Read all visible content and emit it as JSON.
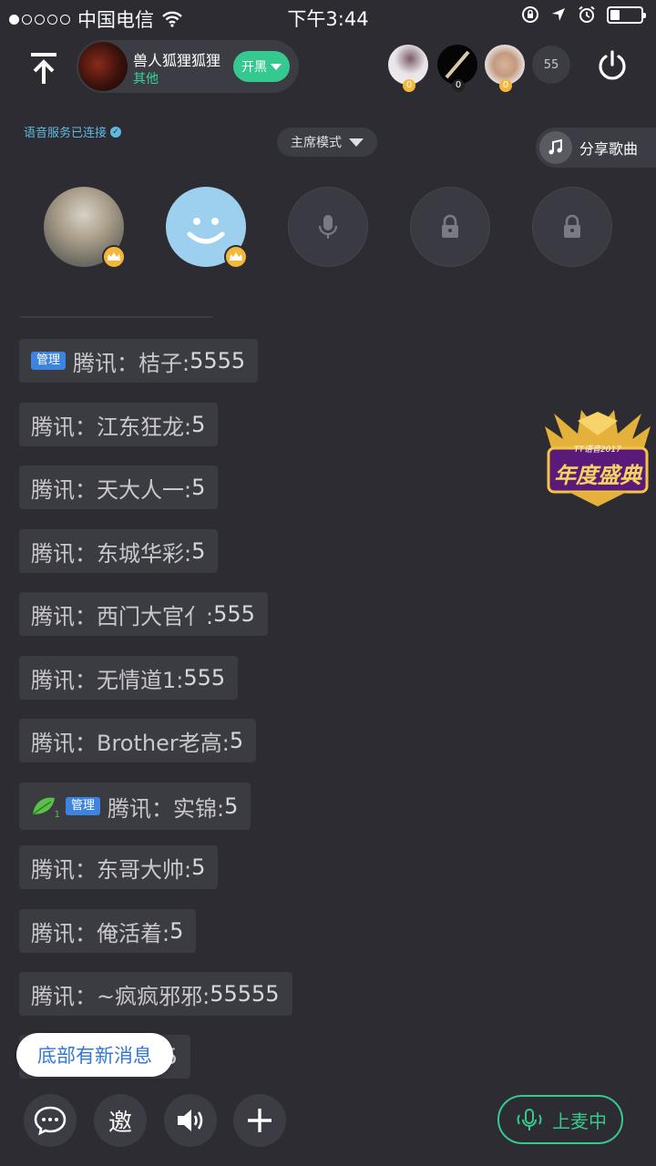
{
  "status_bar": {
    "carrier": "中国电信",
    "time": "下午3:44",
    "signal_dots_full": 1,
    "signal_dots_total": 5,
    "battery_level": 0.3
  },
  "room": {
    "name": "兽人狐狸狐狸",
    "category": "其他",
    "tag_button": "开黑",
    "listener_count": "55",
    "listeners": [
      {
        "badge": "0"
      },
      {
        "badge": "0"
      },
      {
        "badge": "0"
      }
    ]
  },
  "voice_status": "语音服务已连接",
  "mode_selector": "主席模式",
  "share_song": "分享歌曲",
  "seats": [
    {
      "type": "avatar-photo",
      "crown": true
    },
    {
      "type": "avatar-smiley",
      "crown": true
    },
    {
      "type": "mic",
      "crown": false
    },
    {
      "type": "locked",
      "crown": false
    },
    {
      "type": "locked",
      "crown": false
    }
  ],
  "messages": [
    {
      "admin": true,
      "leaf": false,
      "sender": "腾讯：桔子:",
      "text": " 5555"
    },
    {
      "admin": false,
      "leaf": false,
      "sender": "腾讯：江东狂龙:",
      "text": " 5"
    },
    {
      "admin": false,
      "leaf": false,
      "sender": "腾讯：天大人一:",
      "text": " 5"
    },
    {
      "admin": false,
      "leaf": false,
      "sender": "腾讯：东城华彩:",
      "text": " 5"
    },
    {
      "admin": false,
      "leaf": false,
      "sender": "腾讯：西门大官亻:",
      "text": " 555"
    },
    {
      "admin": false,
      "leaf": false,
      "sender": "腾讯：无情道1:",
      "text": " 555"
    },
    {
      "admin": false,
      "leaf": false,
      "sender": "腾讯：Brother老高:",
      "text": " 5"
    },
    {
      "admin": true,
      "leaf": true,
      "leaf_level": "1",
      "sender": "腾讯：实锦:",
      "text": " 5"
    },
    {
      "admin": false,
      "leaf": false,
      "sender": "腾讯：东哥大帅:",
      "text": " 5"
    },
    {
      "admin": false,
      "leaf": false,
      "sender": "腾讯：俺活着:",
      "text": " 5"
    },
    {
      "admin": false,
      "leaf": false,
      "sender": "腾讯：~疯疯邪邪:",
      "text": " 55555"
    },
    {
      "admin": false,
      "leaf": false,
      "sender": "",
      "text": "5"
    }
  ],
  "admin_label": "管理",
  "new_message_toast": "底部有新消息",
  "event_badge": {
    "line1": "TT语音2017",
    "line2": "年度盛典"
  },
  "bottom_bar": {
    "invite": "邀",
    "mic_button": "上麦中"
  },
  "colors": {
    "background": "#2c2c32",
    "accent_green": "#35c98c",
    "admin_blue": "#3d84e0",
    "crown_gold": "#f4b739"
  }
}
